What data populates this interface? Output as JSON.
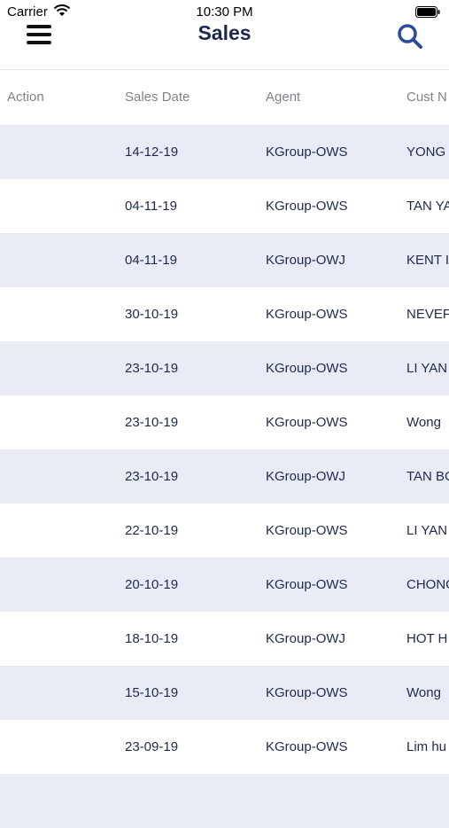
{
  "status_bar": {
    "carrier": "Carrier",
    "time": "10:30 PM"
  },
  "nav": {
    "title": "Sales"
  },
  "table": {
    "columns": [
      "Action",
      "Sales Date",
      "Agent",
      "Cust N"
    ],
    "rows": [
      {
        "action": "",
        "date": "14-12-19",
        "agent": "KGroup-OWS",
        "cust": "YONG"
      },
      {
        "action": "",
        "date": "04-11-19",
        "agent": "KGroup-OWS",
        "cust": "TAN YA"
      },
      {
        "action": "",
        "date": "04-11-19",
        "agent": "KGroup-OWJ",
        "cust": "KENT I"
      },
      {
        "action": "",
        "date": "30-10-19",
        "agent": "KGroup-OWS",
        "cust": "NEVEF"
      },
      {
        "action": "",
        "date": "23-10-19",
        "agent": "KGroup-OWS",
        "cust": "LI YAN"
      },
      {
        "action": "",
        "date": "23-10-19",
        "agent": "KGroup-OWS",
        "cust": "Wong"
      },
      {
        "action": "",
        "date": "23-10-19",
        "agent": "KGroup-OWJ",
        "cust": "TAN BO"
      },
      {
        "action": "",
        "date": "22-10-19",
        "agent": "KGroup-OWS",
        "cust": "LI YAN"
      },
      {
        "action": "",
        "date": "20-10-19",
        "agent": "KGroup-OWS",
        "cust": "CHONG"
      },
      {
        "action": "",
        "date": "18-10-19",
        "agent": "KGroup-OWJ",
        "cust": "HOT H"
      },
      {
        "action": "",
        "date": "15-10-19",
        "agent": "KGroup-OWS",
        "cust": "Wong"
      },
      {
        "action": "",
        "date": "23-09-19",
        "agent": "KGroup-OWS",
        "cust": "Lim hu"
      },
      {
        "action": "",
        "date": "",
        "agent": "",
        "cust": ""
      }
    ]
  },
  "icons": {
    "menu": "hamburger-menu-icon",
    "search": "search-icon",
    "wifi": "wifi-icon",
    "battery": "battery-icon"
  },
  "colors": {
    "title": "#1e2a4c",
    "accent": "#2c4a9a",
    "row_alt": "#e9ecf7",
    "header_text": "#7f8288"
  }
}
